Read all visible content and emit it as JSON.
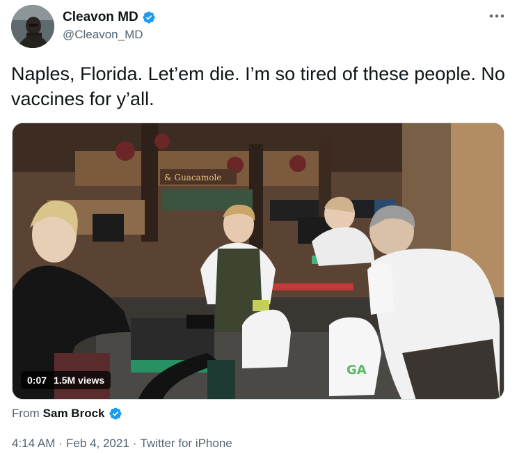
{
  "author": {
    "display_name": "Cleavon MD",
    "handle": "@Cleavon_MD",
    "verified": true,
    "avatar_icon": "profile-photo"
  },
  "more_icon": "ellipsis-horizontal-icon",
  "tweet": {
    "text": "Naples, Florida. Let’em die. I’m so tired of these people. No vaccines for y’all."
  },
  "media": {
    "type": "video",
    "elapsed": "0:07",
    "views": "1.5M views",
    "scene_sign": "& Guacamole"
  },
  "attribution": {
    "prefix": "From",
    "source_name": "Sam Brock",
    "source_verified": true
  },
  "meta": {
    "time": "4:14 AM",
    "sep1": "·",
    "date": "Feb 4, 2021",
    "sep2": "·",
    "client": "Twitter for iPhone"
  },
  "colors": {
    "verified_blue": "#1d9bf0",
    "text_primary": "#0f1419",
    "text_secondary": "#536471"
  }
}
